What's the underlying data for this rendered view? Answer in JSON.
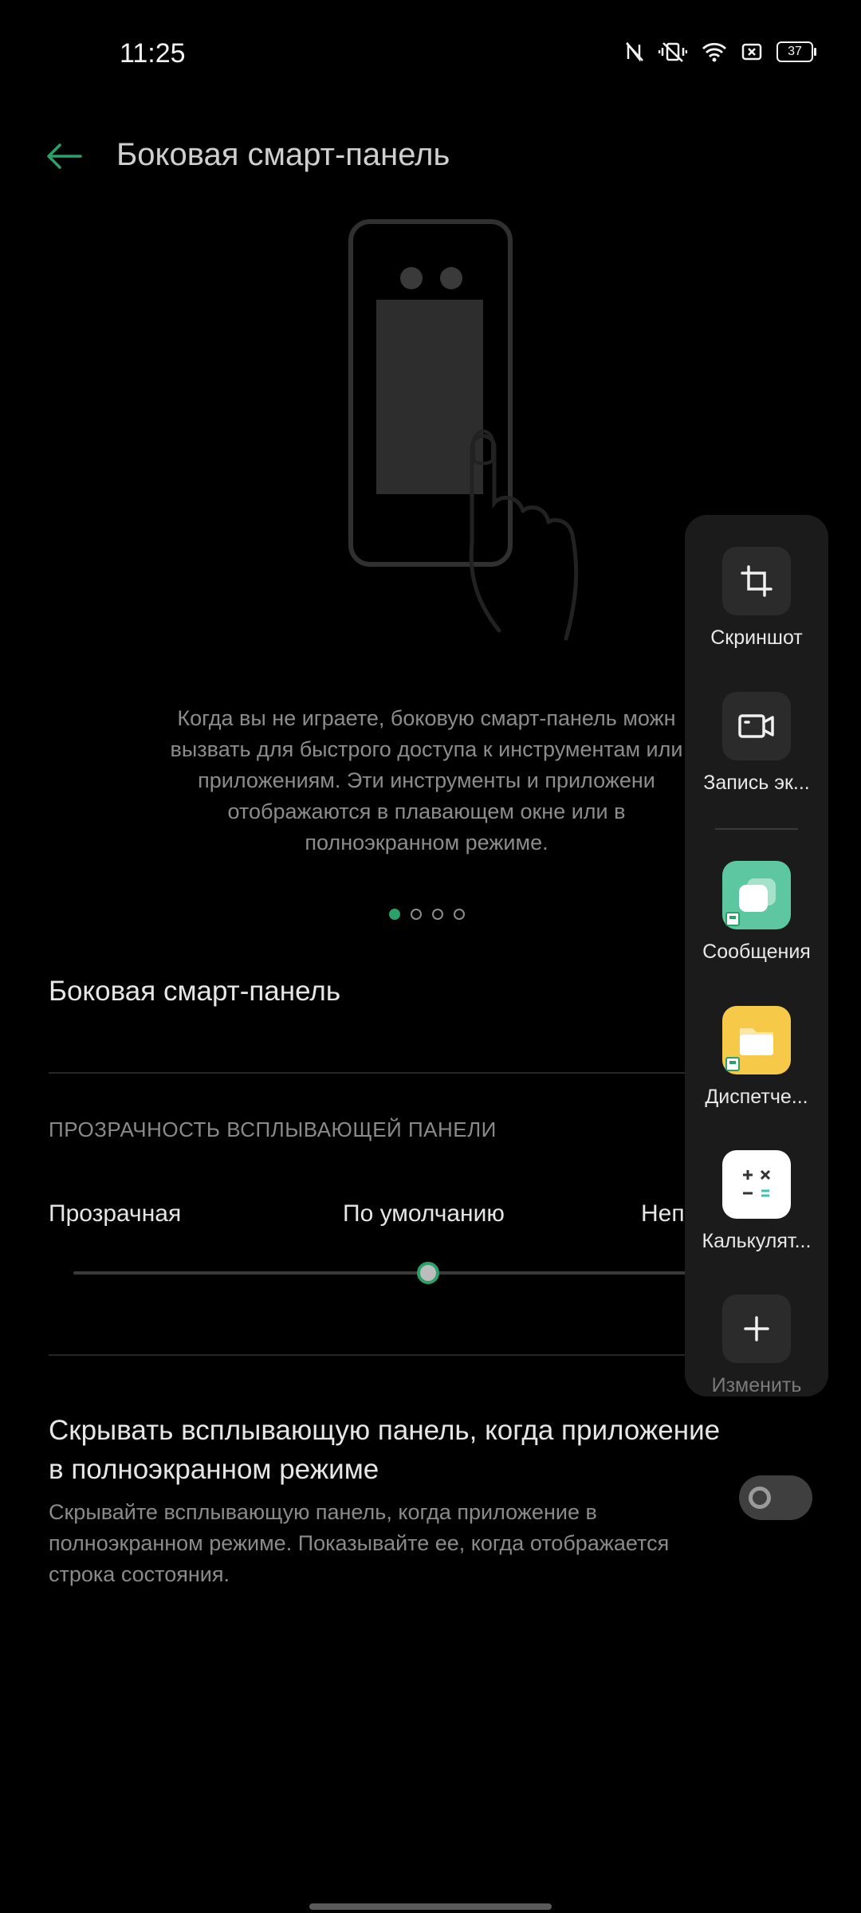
{
  "status_bar": {
    "time": "11:25",
    "battery": "37",
    "icons": [
      "nfc-off-icon",
      "vibrate-off-icon",
      "wifi-icon",
      "sim-icon",
      "battery-icon"
    ]
  },
  "header": {
    "title": "Боковая смарт-панель",
    "back_icon": "arrow-left-icon"
  },
  "illustration": {
    "icon": "phone-with-hand-swipe-illustration"
  },
  "description": "Когда вы не играете, боковую смарт-панель можн вызвать для быстрого доступа к инструментам или приложениям. Эти инструменты и приложени отображаются в плавающем окне или в полноэкранном режиме.",
  "pagination": {
    "count": 4,
    "active_index": 0
  },
  "settings": {
    "toggle_label": "Боковая смарт-панель",
    "section_header": "ПРОЗРАЧНОСТЬ ВСПЛЫВАЮЩЕЙ ПАНЕЛИ",
    "slider": {
      "labels": [
        "Прозрачная",
        "По умолчанию",
        "Неп"
      ],
      "value_fraction": 0.5
    },
    "hide_title": "Скрывать всплывающую панель, когда приложение в полноэкранном режиме",
    "hide_desc": "Скрывайте всплывающую панель, когда приложение в полноэкранном режиме. Показывайте ее, когда отображается строка состояния.",
    "hide_toggle_on": false
  },
  "side_panel": {
    "tools": [
      {
        "label": "Скриншот",
        "icon": "crop-icon"
      },
      {
        "label": "Запись эк...",
        "icon": "video-camera-icon"
      }
    ],
    "apps": [
      {
        "label": "Сообщения",
        "icon": "messages-icon",
        "color": "#5cc7a1"
      },
      {
        "label": "Диспетче...",
        "icon": "folder-icon",
        "color": "#f7c948"
      },
      {
        "label": "Калькулят...",
        "icon": "calculator-icon",
        "color": "#ffffff"
      }
    ],
    "edit_label": "Изменить",
    "edit_icon": "plus-icon"
  },
  "colors": {
    "accent": "#2aa16b",
    "background": "#000000",
    "panel": "#1b1b1b"
  }
}
